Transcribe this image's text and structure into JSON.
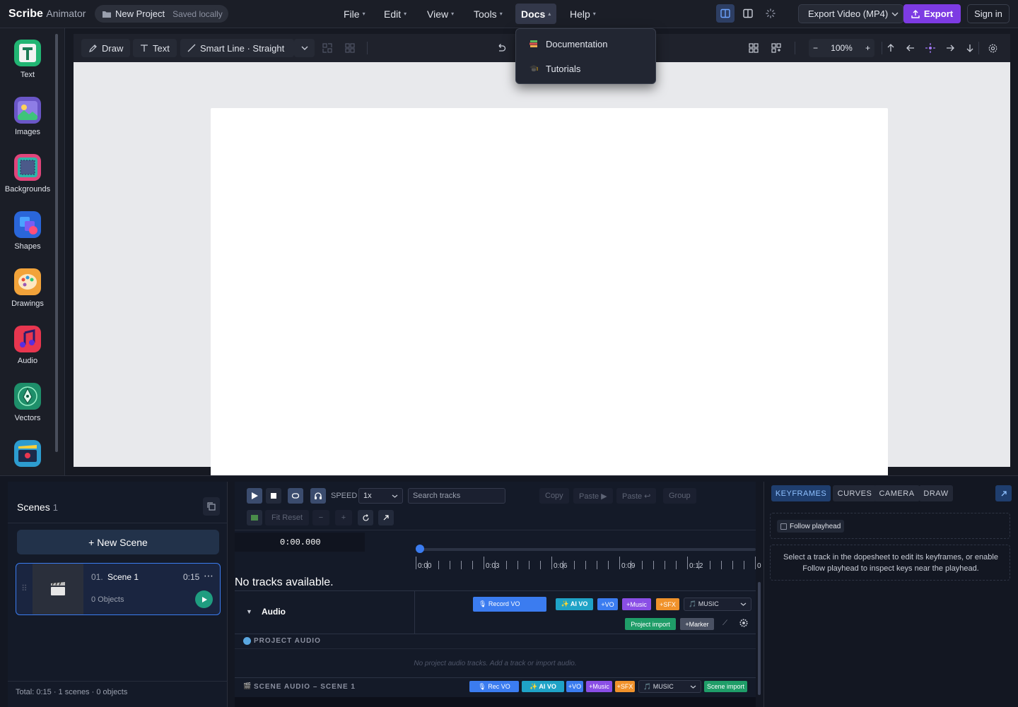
{
  "app": {
    "brand_bold": "Scribe",
    "brand_light": "Animator"
  },
  "project": {
    "name": "New Project",
    "status": "Saved locally"
  },
  "menus": [
    "File",
    "Edit",
    "View",
    "Tools",
    "Docs",
    "Help"
  ],
  "export": {
    "format": "Export Video (MP4)",
    "button": "Export"
  },
  "auth": {
    "signin": "Sign in"
  },
  "docs_menu": {
    "items": [
      "Documentation",
      "Tutorials"
    ]
  },
  "rail": {
    "items": [
      "Text",
      "Images",
      "Backgrounds",
      "Shapes",
      "Drawings",
      "Audio",
      "Vectors"
    ]
  },
  "canvas_toolbar": {
    "draw": "Draw",
    "text": "Text",
    "smart_line": "Smart Line · Straight",
    "zoom": "100%"
  },
  "scenes": {
    "title": "Scenes",
    "count": "1",
    "new_scene": "+ New Scene",
    "card": {
      "index": "01.",
      "name": "Scene 1",
      "duration": "0:15",
      "objects": "0 Objects"
    },
    "footer": "Total: 0:15 · 1 scenes · 0 objects"
  },
  "timeline": {
    "speed_label": "SPEED",
    "speed_value": "1x",
    "search_placeholder": "Search tracks",
    "actions": [
      "Copy",
      "Paste ▶",
      "Paste ↩",
      "Group"
    ],
    "fit_reset": "Fit Reset",
    "timecode": "0:00.000",
    "ruler": [
      "0:00",
      "0:03",
      "0:06",
      "0:09",
      "0:12",
      "0"
    ],
    "no_tracks": "No tracks available.",
    "audio_label": "Audio",
    "chips": {
      "record_vo": "🎙 Record VO",
      "ai_vo": "✨ AI VO",
      "vo": "+VO",
      "music": "+Music",
      "sfx": "+SFX",
      "music_sel": "🎵 MUSIC",
      "project_import": "Project import",
      "marker": "+Marker"
    },
    "project_audio": "PROJECT AUDIO",
    "project_audio_empty": "No project audio tracks. Add a track or import audio.",
    "scene_audio": "SCENE AUDIO – SCENE 1",
    "scene_chips": {
      "rec_vo": "🎙 Rec VO",
      "ai_vo": "✨ AI VO",
      "vo": "+VO",
      "music": "+Music",
      "sfx": "+SFX",
      "music_sel": "🎵 MUSIC",
      "scene_import": "Scene import"
    }
  },
  "inspector": {
    "tabs": [
      "KEYFRAMES",
      "CURVES",
      "CAMERA",
      "DRAW"
    ],
    "follow": "Follow playhead",
    "hint": "Select a track in the dopesheet to edit its keyframes, or enable Follow playhead to inspect keys near the playhead."
  },
  "colors": {
    "accent": "#7d3be3",
    "blue": "#3b7cf0",
    "teal": "#1f9d80"
  }
}
